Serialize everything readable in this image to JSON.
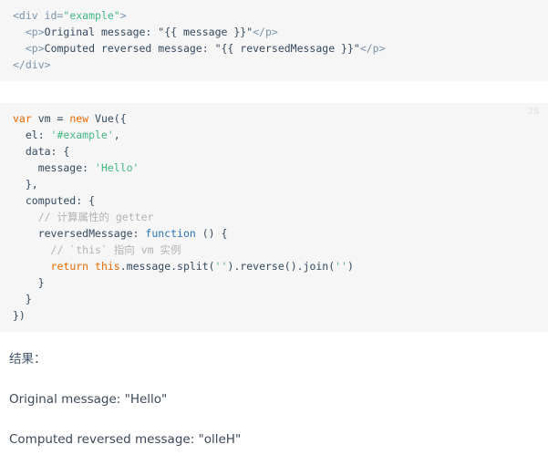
{
  "code_blocks": [
    {
      "language": "html",
      "badge": "",
      "lines": [
        [
          {
            "t": "tag",
            "v": "<div "
          },
          {
            "t": "attr",
            "v": "id="
          },
          {
            "t": "string",
            "v": "\"example\""
          },
          {
            "t": "tag",
            "v": ">"
          }
        ],
        [
          {
            "t": "plain",
            "v": "  "
          },
          {
            "t": "tag",
            "v": "<p>"
          },
          {
            "t": "plain",
            "v": "Original message: \"{{ message }}\""
          },
          {
            "t": "tag",
            "v": "</p>"
          }
        ],
        [
          {
            "t": "plain",
            "v": "  "
          },
          {
            "t": "tag",
            "v": "<p>"
          },
          {
            "t": "plain",
            "v": "Computed reversed message: \"{{ reversedMessage }}\""
          },
          {
            "t": "tag",
            "v": "</p>"
          }
        ],
        [
          {
            "t": "tag",
            "v": "</div>"
          }
        ]
      ]
    },
    {
      "language": "js",
      "badge": "JS",
      "lines": [
        [
          {
            "t": "keyword",
            "v": "var"
          },
          {
            "t": "plain",
            "v": " vm = "
          },
          {
            "t": "keyword",
            "v": "new"
          },
          {
            "t": "plain",
            "v": " Vue({"
          }
        ],
        [
          {
            "t": "plain",
            "v": "  el: "
          },
          {
            "t": "string",
            "v": "'#example'"
          },
          {
            "t": "plain",
            "v": ","
          }
        ],
        [
          {
            "t": "plain",
            "v": "  data: {"
          }
        ],
        [
          {
            "t": "plain",
            "v": "    message: "
          },
          {
            "t": "string",
            "v": "'Hello'"
          }
        ],
        [
          {
            "t": "plain",
            "v": "  },"
          }
        ],
        [
          {
            "t": "plain",
            "v": "  computed: {"
          }
        ],
        [
          {
            "t": "comment",
            "v": "    // 计算属性的 getter"
          }
        ],
        [
          {
            "t": "plain",
            "v": "    reversedMessage: "
          },
          {
            "t": "func",
            "v": "function"
          },
          {
            "t": "plain",
            "v": " () {"
          }
        ],
        [
          {
            "t": "comment",
            "v": "      // `this` 指向 vm 实例"
          }
        ],
        [
          {
            "t": "plain",
            "v": "      "
          },
          {
            "t": "keyword",
            "v": "return"
          },
          {
            "t": "plain",
            "v": " "
          },
          {
            "t": "keyword",
            "v": "this"
          },
          {
            "t": "plain",
            "v": ".message.split("
          },
          {
            "t": "string",
            "v": "''"
          },
          {
            "t": "plain",
            "v": ").reverse().join("
          },
          {
            "t": "string",
            "v": "''"
          },
          {
            "t": "plain",
            "v": ")"
          }
        ],
        [
          {
            "t": "plain",
            "v": "    }"
          }
        ],
        [
          {
            "t": "plain",
            "v": "  }"
          }
        ],
        [
          {
            "t": "plain",
            "v": "})"
          }
        ]
      ]
    }
  ],
  "result": {
    "heading": "结果：",
    "lines": [
      "Original message: \"Hello\"",
      "Computed reversed message: \"olleH\""
    ]
  },
  "colors": {
    "code_background": "#f6f6f6",
    "page_background": "#ffffff",
    "text": "#34495e",
    "string": "#42b983",
    "keyword": "#e96900",
    "function": "#2973b7",
    "comment": "#b3b3b3",
    "tag": "#7a93ab",
    "heading": "#42556b",
    "badge": "#e4e4e4"
  }
}
